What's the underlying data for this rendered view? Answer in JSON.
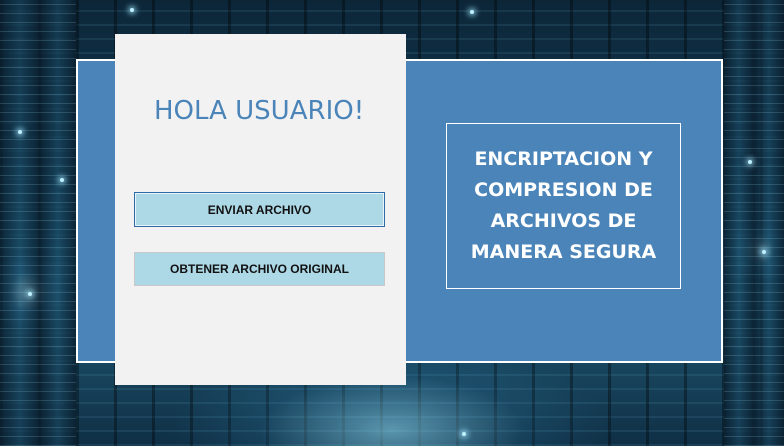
{
  "greeting": "HOLA USUARIO!",
  "buttons": {
    "send_file": "ENVIAR ARCHIVO",
    "get_original": "OBTENER ARCHIVO ORIGINAL"
  },
  "title": {
    "line1": "ENCRIPTACION Y",
    "line2": "COMPRESION DE",
    "line3": "ARCHIVOS DE",
    "line4": "MANERA SEGURA"
  },
  "colors": {
    "frame_blue": "#4a84b8",
    "panel_gray": "#f2f2f2",
    "button_light_blue": "#add8e6",
    "greeting_text": "#4a84b8"
  }
}
